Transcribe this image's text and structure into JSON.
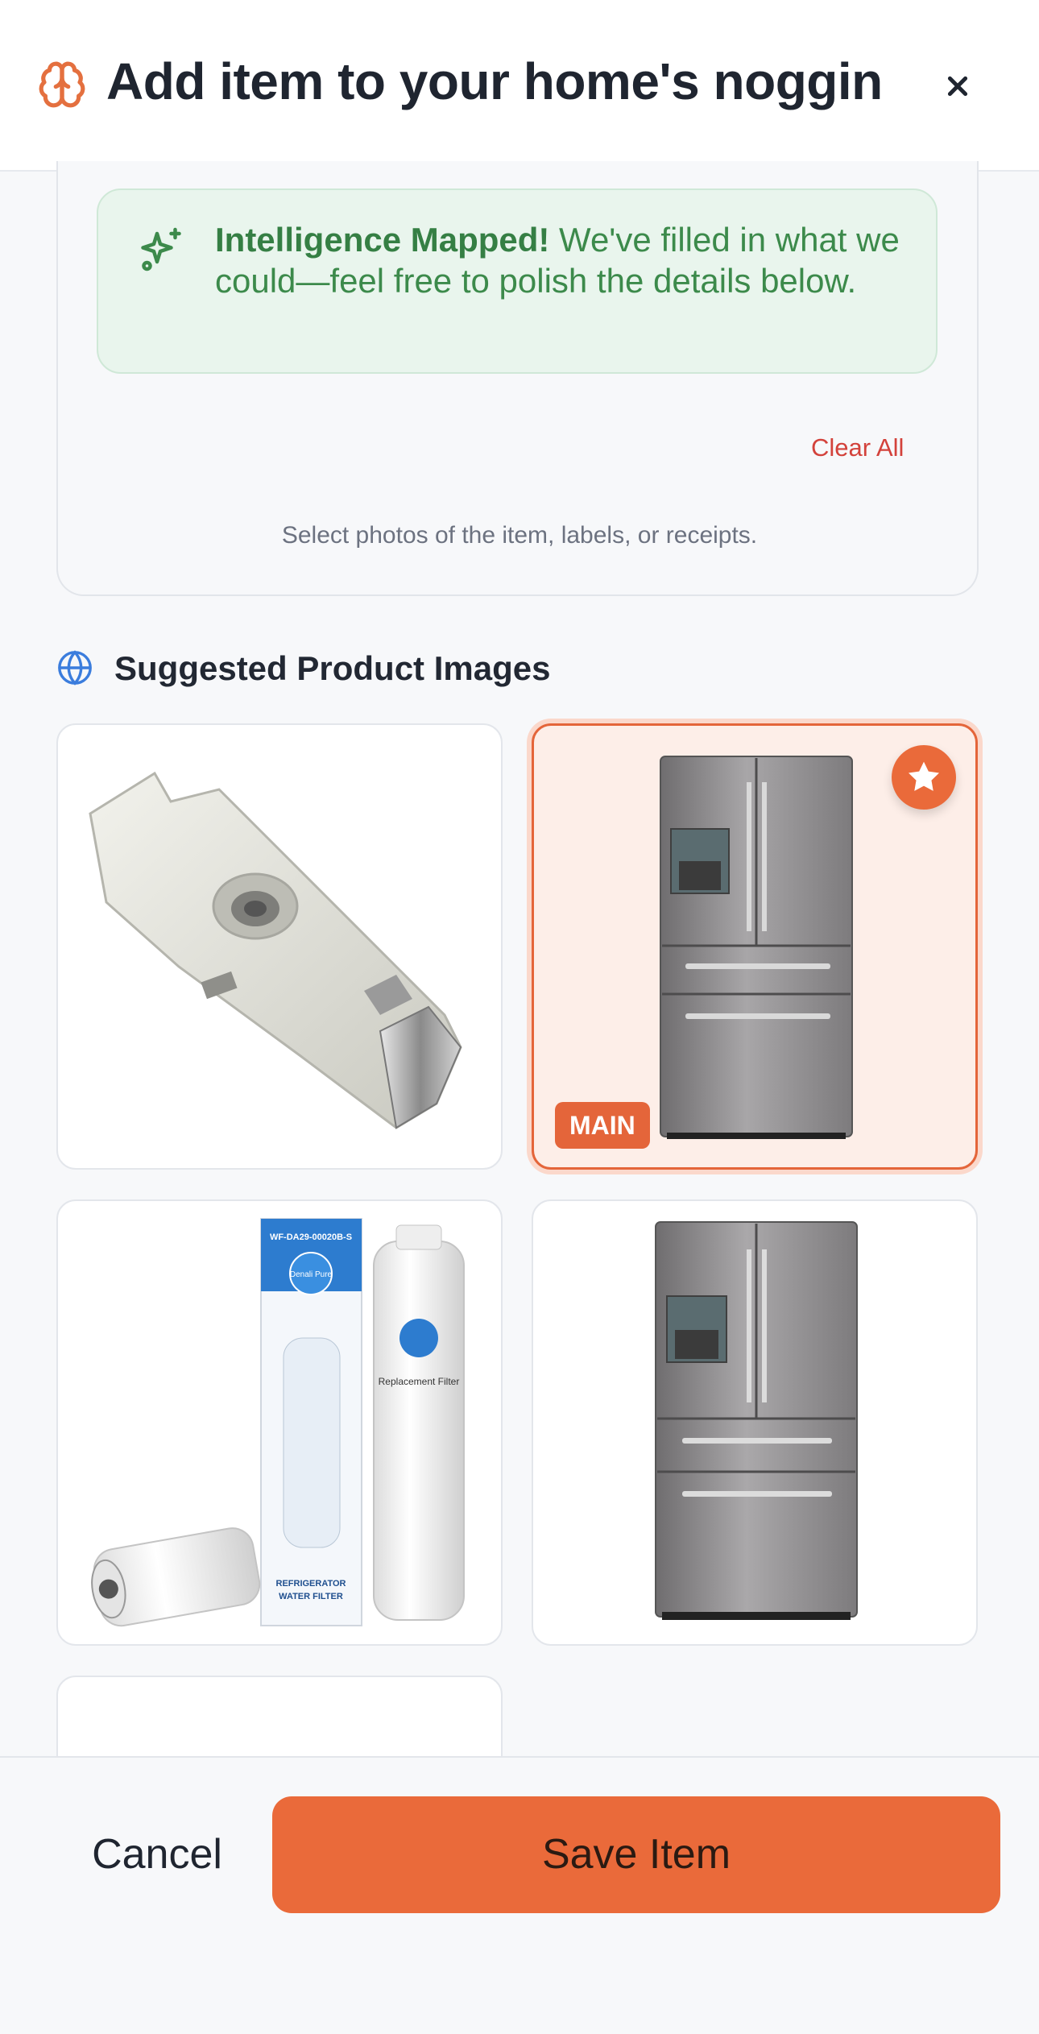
{
  "header": {
    "title": "Add item to your home's noggin",
    "close_icon": "close-icon",
    "brand_icon": "brain-icon"
  },
  "ai_banner": {
    "icon": "sparkle-icon",
    "bold": "Intelligence Mapped!",
    "message": " We've filled in what we could—feel free to polish the details below."
  },
  "upload": {
    "clear_all_label": "Clear All",
    "hint": "Select photos of the item, labels, or receipts."
  },
  "suggestions": {
    "icon": "globe-icon",
    "title": "Suggested Product Images",
    "images": [
      {
        "subject": "filter-adapter",
        "is_main": false
      },
      {
        "subject": "french-door-refrigerator",
        "is_main": true,
        "badge": "MAIN"
      },
      {
        "subject": "water-filter-box",
        "is_main": false
      },
      {
        "subject": "french-door-refrigerator",
        "is_main": false
      },
      {
        "subject": "empty",
        "is_main": false
      }
    ],
    "box_text": {
      "model": "WF-DA29-00020B-S",
      "brand": "Denali Pure",
      "product": "Replacement Filter",
      "box_label_line1": "REFRIGERATOR",
      "box_label_line2": "WATER FILTER"
    }
  },
  "footer": {
    "cancel_label": "Cancel",
    "save_label": "Save Item"
  },
  "colors": {
    "accent": "#ea6a3a",
    "success_bg": "#e9f5ed",
    "success_text": "#3c8a4b",
    "danger": "#d3423b"
  }
}
